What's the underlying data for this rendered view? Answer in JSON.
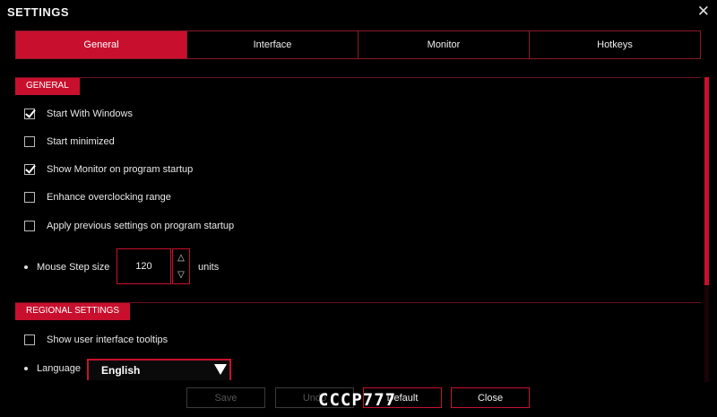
{
  "window": {
    "title": "SETTINGS",
    "close_icon": "close-icon"
  },
  "tabs": [
    {
      "label": "General",
      "active": true
    },
    {
      "label": "Interface",
      "active": false
    },
    {
      "label": "Monitor",
      "active": false
    },
    {
      "label": "Hotkeys",
      "active": false
    }
  ],
  "general": {
    "header": "GENERAL",
    "checkboxes": [
      {
        "label": "Start With Windows",
        "checked": true
      },
      {
        "label": "Start minimized",
        "checked": false
      },
      {
        "label": "Show Monitor on program startup",
        "checked": true
      },
      {
        "label": "Enhance overclocking range",
        "checked": false
      },
      {
        "label": "Apply previous settings on program startup",
        "checked": false
      }
    ],
    "mouse_step": {
      "label": "Mouse Step size",
      "value": "120",
      "units": "units",
      "up": "△",
      "down": "▽"
    }
  },
  "regional": {
    "header": "REGIONAL SETTINGS",
    "tooltips_checkbox": {
      "label": "Show user interface tooltips",
      "checked": false
    },
    "language": {
      "label": "Language",
      "value": "English"
    }
  },
  "buttons": {
    "save": "Save",
    "undo": "Undo",
    "default": "Default",
    "close": "Close"
  },
  "watermark": "CCCP777",
  "colors": {
    "accent": "#c8102e",
    "background": "#000000"
  }
}
